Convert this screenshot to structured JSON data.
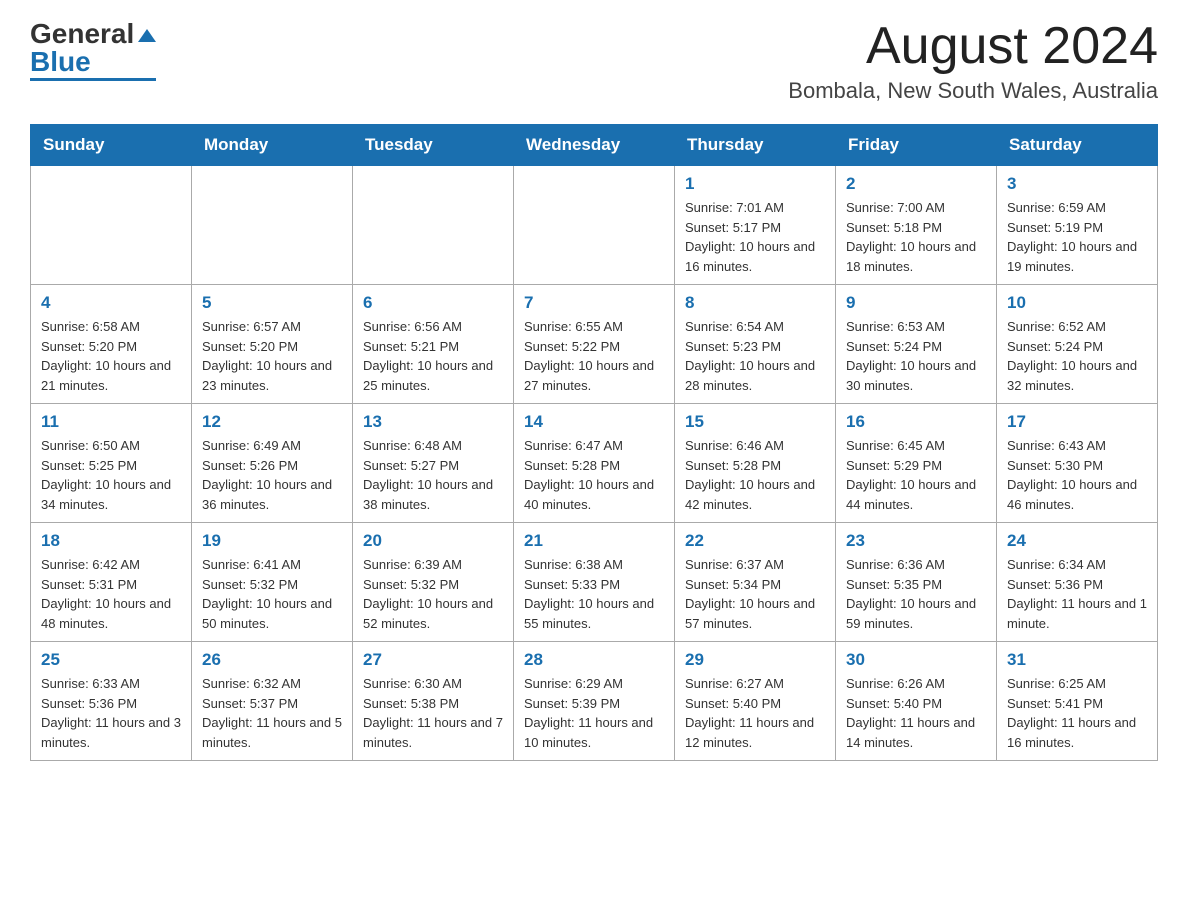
{
  "header": {
    "logo_general": "General",
    "logo_blue": "Blue",
    "month_title": "August 2024",
    "location": "Bombala, New South Wales, Australia"
  },
  "days_of_week": [
    "Sunday",
    "Monday",
    "Tuesday",
    "Wednesday",
    "Thursday",
    "Friday",
    "Saturday"
  ],
  "weeks": [
    {
      "days": [
        {
          "number": "",
          "info": ""
        },
        {
          "number": "",
          "info": ""
        },
        {
          "number": "",
          "info": ""
        },
        {
          "number": "",
          "info": ""
        },
        {
          "number": "1",
          "info": "Sunrise: 7:01 AM\nSunset: 5:17 PM\nDaylight: 10 hours and 16 minutes."
        },
        {
          "number": "2",
          "info": "Sunrise: 7:00 AM\nSunset: 5:18 PM\nDaylight: 10 hours and 18 minutes."
        },
        {
          "number": "3",
          "info": "Sunrise: 6:59 AM\nSunset: 5:19 PM\nDaylight: 10 hours and 19 minutes."
        }
      ]
    },
    {
      "days": [
        {
          "number": "4",
          "info": "Sunrise: 6:58 AM\nSunset: 5:20 PM\nDaylight: 10 hours and 21 minutes."
        },
        {
          "number": "5",
          "info": "Sunrise: 6:57 AM\nSunset: 5:20 PM\nDaylight: 10 hours and 23 minutes."
        },
        {
          "number": "6",
          "info": "Sunrise: 6:56 AM\nSunset: 5:21 PM\nDaylight: 10 hours and 25 minutes."
        },
        {
          "number": "7",
          "info": "Sunrise: 6:55 AM\nSunset: 5:22 PM\nDaylight: 10 hours and 27 minutes."
        },
        {
          "number": "8",
          "info": "Sunrise: 6:54 AM\nSunset: 5:23 PM\nDaylight: 10 hours and 28 minutes."
        },
        {
          "number": "9",
          "info": "Sunrise: 6:53 AM\nSunset: 5:24 PM\nDaylight: 10 hours and 30 minutes."
        },
        {
          "number": "10",
          "info": "Sunrise: 6:52 AM\nSunset: 5:24 PM\nDaylight: 10 hours and 32 minutes."
        }
      ]
    },
    {
      "days": [
        {
          "number": "11",
          "info": "Sunrise: 6:50 AM\nSunset: 5:25 PM\nDaylight: 10 hours and 34 minutes."
        },
        {
          "number": "12",
          "info": "Sunrise: 6:49 AM\nSunset: 5:26 PM\nDaylight: 10 hours and 36 minutes."
        },
        {
          "number": "13",
          "info": "Sunrise: 6:48 AM\nSunset: 5:27 PM\nDaylight: 10 hours and 38 minutes."
        },
        {
          "number": "14",
          "info": "Sunrise: 6:47 AM\nSunset: 5:28 PM\nDaylight: 10 hours and 40 minutes."
        },
        {
          "number": "15",
          "info": "Sunrise: 6:46 AM\nSunset: 5:28 PM\nDaylight: 10 hours and 42 minutes."
        },
        {
          "number": "16",
          "info": "Sunrise: 6:45 AM\nSunset: 5:29 PM\nDaylight: 10 hours and 44 minutes."
        },
        {
          "number": "17",
          "info": "Sunrise: 6:43 AM\nSunset: 5:30 PM\nDaylight: 10 hours and 46 minutes."
        }
      ]
    },
    {
      "days": [
        {
          "number": "18",
          "info": "Sunrise: 6:42 AM\nSunset: 5:31 PM\nDaylight: 10 hours and 48 minutes."
        },
        {
          "number": "19",
          "info": "Sunrise: 6:41 AM\nSunset: 5:32 PM\nDaylight: 10 hours and 50 minutes."
        },
        {
          "number": "20",
          "info": "Sunrise: 6:39 AM\nSunset: 5:32 PM\nDaylight: 10 hours and 52 minutes."
        },
        {
          "number": "21",
          "info": "Sunrise: 6:38 AM\nSunset: 5:33 PM\nDaylight: 10 hours and 55 minutes."
        },
        {
          "number": "22",
          "info": "Sunrise: 6:37 AM\nSunset: 5:34 PM\nDaylight: 10 hours and 57 minutes."
        },
        {
          "number": "23",
          "info": "Sunrise: 6:36 AM\nSunset: 5:35 PM\nDaylight: 10 hours and 59 minutes."
        },
        {
          "number": "24",
          "info": "Sunrise: 6:34 AM\nSunset: 5:36 PM\nDaylight: 11 hours and 1 minute."
        }
      ]
    },
    {
      "days": [
        {
          "number": "25",
          "info": "Sunrise: 6:33 AM\nSunset: 5:36 PM\nDaylight: 11 hours and 3 minutes."
        },
        {
          "number": "26",
          "info": "Sunrise: 6:32 AM\nSunset: 5:37 PM\nDaylight: 11 hours and 5 minutes."
        },
        {
          "number": "27",
          "info": "Sunrise: 6:30 AM\nSunset: 5:38 PM\nDaylight: 11 hours and 7 minutes."
        },
        {
          "number": "28",
          "info": "Sunrise: 6:29 AM\nSunset: 5:39 PM\nDaylight: 11 hours and 10 minutes."
        },
        {
          "number": "29",
          "info": "Sunrise: 6:27 AM\nSunset: 5:40 PM\nDaylight: 11 hours and 12 minutes."
        },
        {
          "number": "30",
          "info": "Sunrise: 6:26 AM\nSunset: 5:40 PM\nDaylight: 11 hours and 14 minutes."
        },
        {
          "number": "31",
          "info": "Sunrise: 6:25 AM\nSunset: 5:41 PM\nDaylight: 11 hours and 16 minutes."
        }
      ]
    }
  ]
}
